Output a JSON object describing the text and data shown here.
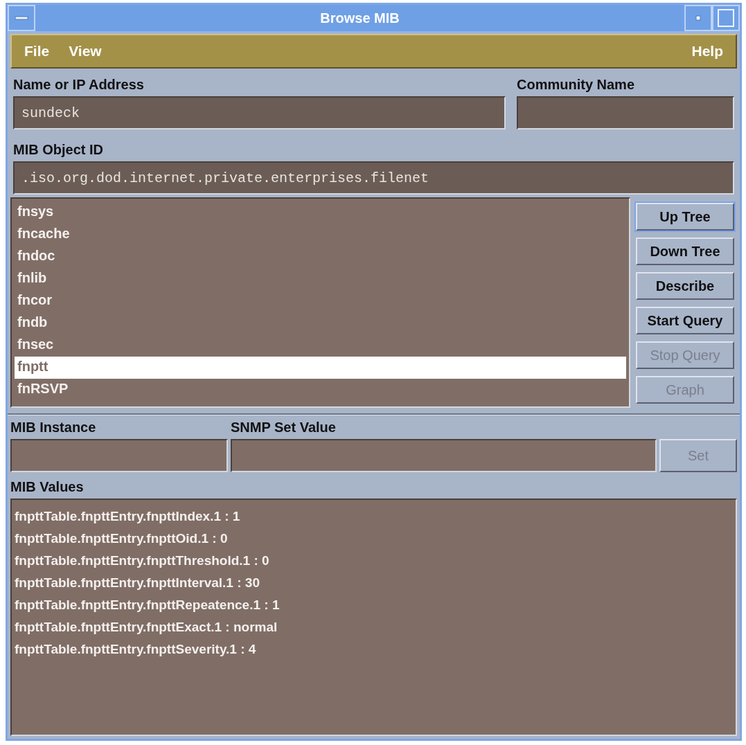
{
  "window": {
    "title": "Browse MIB"
  },
  "menu": {
    "left": [
      "File",
      "View"
    ],
    "right": [
      "Help"
    ]
  },
  "host": {
    "label": "Name or IP Address",
    "value": "sundeck"
  },
  "community": {
    "label": "Community Name"
  },
  "object_id": {
    "label": "MIB Object ID",
    "value": ".iso.org.dod.internet.private.enterprises.filenet"
  },
  "tree_items": [
    {
      "label": "fnsys",
      "selected": false
    },
    {
      "label": "fncache",
      "selected": false
    },
    {
      "label": "fndoc",
      "selected": false
    },
    {
      "label": "fnlib",
      "selected": false
    },
    {
      "label": "fncor",
      "selected": false
    },
    {
      "label": "fndb",
      "selected": false
    },
    {
      "label": "fnsec",
      "selected": false
    },
    {
      "label": "fnptt",
      "selected": true
    },
    {
      "label": "fnRSVP",
      "selected": false
    }
  ],
  "tree_buttons": [
    {
      "label": "Up Tree",
      "disabled": false
    },
    {
      "label": "Down Tree",
      "disabled": false
    },
    {
      "label": "Describe",
      "disabled": false
    },
    {
      "label": "Start Query",
      "disabled": false
    },
    {
      "label": "Stop Query",
      "disabled": true
    },
    {
      "label": "Graph",
      "disabled": true
    }
  ],
  "instance": {
    "label": "MIB Instance"
  },
  "set_value": {
    "label": "SNMP Set Value"
  },
  "set_button": {
    "label": "Set",
    "disabled": true
  },
  "values": {
    "label": "MIB Values",
    "lines": [
      "fnpttTable.fnpttEntry.fnpttIndex.1 : 1",
      "fnpttTable.fnpttEntry.fnpttOid.1 : 0",
      "fnpttTable.fnpttEntry.fnpttThreshold.1 : 0",
      "fnpttTable.fnpttEntry.fnpttInterval.1 : 30",
      "fnpttTable.fnpttEntry.fnpttRepeatence.1 : 1",
      "fnpttTable.fnpttEntry.fnpttExact.1 : normal",
      "fnpttTable.fnpttEntry.fnpttSeverity.1 : 4"
    ]
  }
}
